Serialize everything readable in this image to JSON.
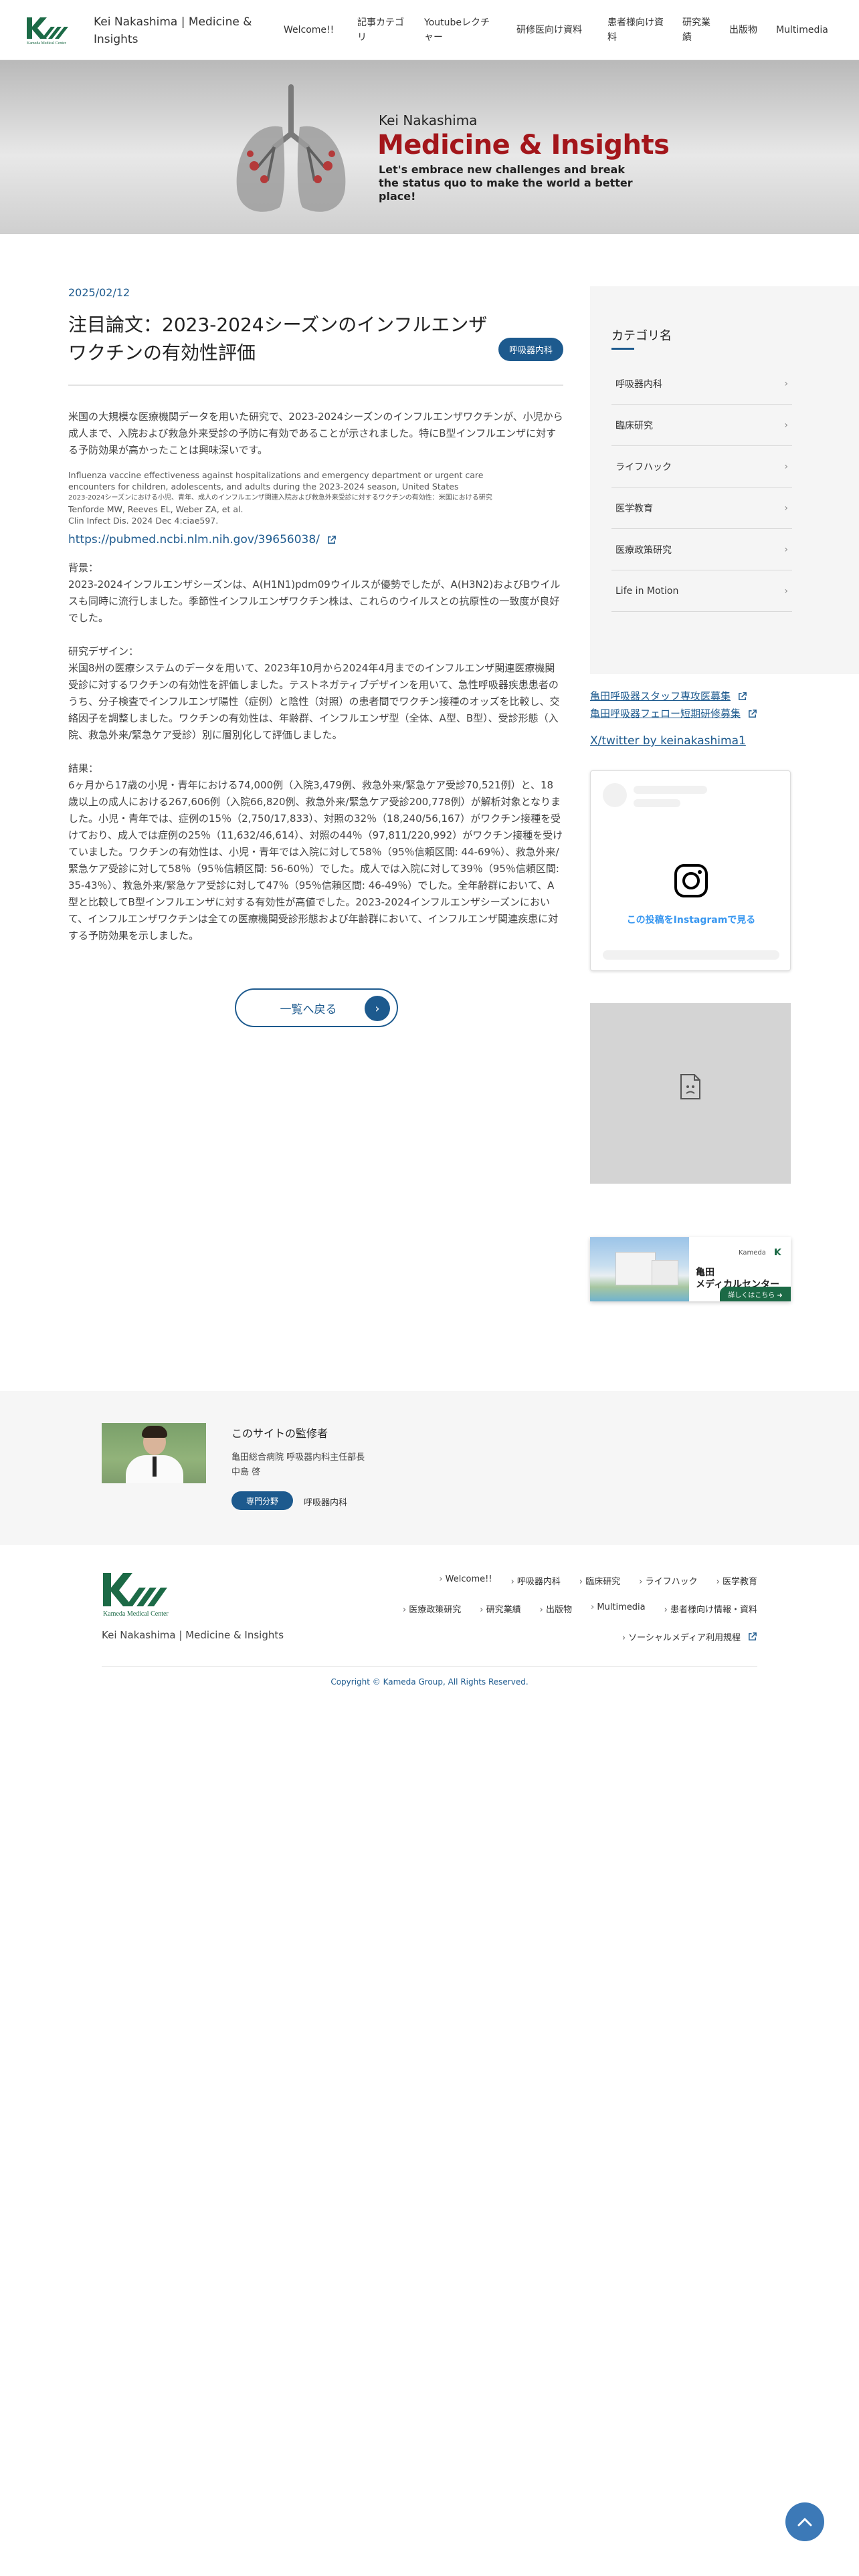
{
  "header": {
    "site_title": "Kei Nakashima | Medicine & Insights",
    "logo_text": "Kameda Medical Center",
    "nav": [
      "Welcome!!",
      "記事カテゴリ",
      "Youtubeレクチャー",
      "研修医向け資料",
      "患者様向け資料",
      "研究業績",
      "出版物",
      "Multimedia"
    ]
  },
  "hero": {
    "name": "Kei Nakashima",
    "title": "Medicine & Insights",
    "tagline": "Let's embrace new challenges and break the status quo to make the world a better place!"
  },
  "article": {
    "date": "2025/02/12",
    "title": "注目論文：2023-2024シーズンのインフルエンザワクチンの有効性評価",
    "category": "呼吸器内科",
    "lead": "米国の大規模な医療機関データを用いた研究で、2023-2024シーズンのインフルエンザワクチンが、小児から成人まで、入院および救急外来受診の予防に有効であることが示されました。特にB型インフルエンザに対する予防効果が高かったことは興味深いです。",
    "citation_lines": [
      "Influenza vaccine effectiveness against hospitalizations and emergency department or urgent care",
      "encounters for children, adolescents, and adults during the 2023-2024 season, United States",
      "2023-2024シーズンにおける小児、青年、成人のインフルエンザ関連入院および救急外来受診に対するワクチンの有効性：米国における研究",
      "Tenforde MW, Reeves EL, Weber ZA, et al.",
      "Clin Infect Dis. 2024 Dec 4:ciae597."
    ],
    "pubmed_url": "https://pubmed.ncbi.nlm.nih.gov/39656038/",
    "background_head": "背景：",
    "background": "2023-2024インフルエンザシーズンは、A(H1N1)pdm09ウイルスが優勢でしたが、A(H3N2)およびBウイルスも同時に流行しました。季節性インフルエンザワクチン株は、これらのウイルスとの抗原性の一致度が良好でした。",
    "design_head": "研究デザイン：",
    "design": "米国8州の医療システムのデータを用いて、2023年10月から2024年4月までのインフルエンザ関連医療機関受診に対するワクチンの有効性を評価しました。テストネガティブデザインを用いて、急性呼吸器疾患患者のうち、分子検査でインフルエンザ陽性（症例）と陰性（対照）の患者間でワクチン接種のオッズを比較し、交絡因子を調整しました。ワクチンの有効性は、年齢群、インフルエンザ型（全体、A型、B型）、受診形態（入院、救急外来/緊急ケア受診）別に層別化して評価しました。",
    "results_head": "結果：",
    "results": "6ヶ月から17歳の小児・青年における74,000例（入院3,479例、救急外来/緊急ケア受診70,521例）と、18歳以上の成人における267,606例（入院66,820例、救急外来/緊急ケア受診200,778例）が解析対象となりました。小児・青年では、症例の15％（2,750/17,833）、対照の32％（18,240/56,167）がワクチン接種を受けており、成人では症例の25％（11,632/46,614）、対照の44％（97,811/220,992）がワクチン接種を受けていました。ワクチンの有効性は、小児・青年では入院に対して58％（95％信頼区間: 44-69％）、救急外来/緊急ケア受診に対して58％（95％信頼区間: 56-60％）でした。成人では入院に対して39％（95％信頼区間: 35-43％）、救急外来/緊急ケア受診に対して47％（95％信頼区間: 46-49％）でした。全年齢群において、A型と比較してB型インフルエンザに対する有効性が高値でした。2023-2024インフルエンザシーズンにおいて、インフルエンザワクチンは全ての医療機関受診形態および年齢群において、インフルエンザ関連疾患に対する予防効果を示しました。",
    "back_label": "一覧へ戻る"
  },
  "sidebar": {
    "category_heading": "カテゴリ名",
    "categories": [
      "呼吸器内科",
      "臨床研究",
      "ライフハック",
      "医学教育",
      "医療政策研究",
      "Life in Motion"
    ],
    "links": [
      "亀田呼吸器スタッフ専攻医募集",
      "亀田呼吸器フェロー短期研修募集"
    ],
    "twitter": "X/twitter by keinakashima1",
    "instagram_text": "この投稿をInstagramで見る",
    "banner": {
      "brand": "Kameda",
      "name_line1": "亀田",
      "name_line2": "メディカルセンター",
      "button": "詳しくはこちら ➜"
    }
  },
  "supervisor": {
    "label": "このサイトの監修者",
    "affiliation": "亀田総合病院 呼吸器内科主任部長",
    "name": "中島 啓",
    "badge": "専門分野",
    "specialty": "呼吸器内科"
  },
  "footer": {
    "nav_row1": [
      "Welcome!!",
      "呼吸器内科",
      "臨床研究",
      "ライフハック",
      "医学教育"
    ],
    "nav_row2": [
      "医療政策研究",
      "研究業績",
      "出版物",
      "Multimedia",
      "患者様向け情報・資料"
    ],
    "nav_row3": "ソーシャルメディア利用規程",
    "site_title": "Kei Nakashima | Medicine & Insights",
    "logo_text": "Kameda Medical Center",
    "copyright": "Copyright © Kameda Group, All Rights Reserved."
  },
  "colors": {
    "primary": "#1d5a8e",
    "hero_red": "#a3161b",
    "logo_green": "#1c6a46"
  }
}
